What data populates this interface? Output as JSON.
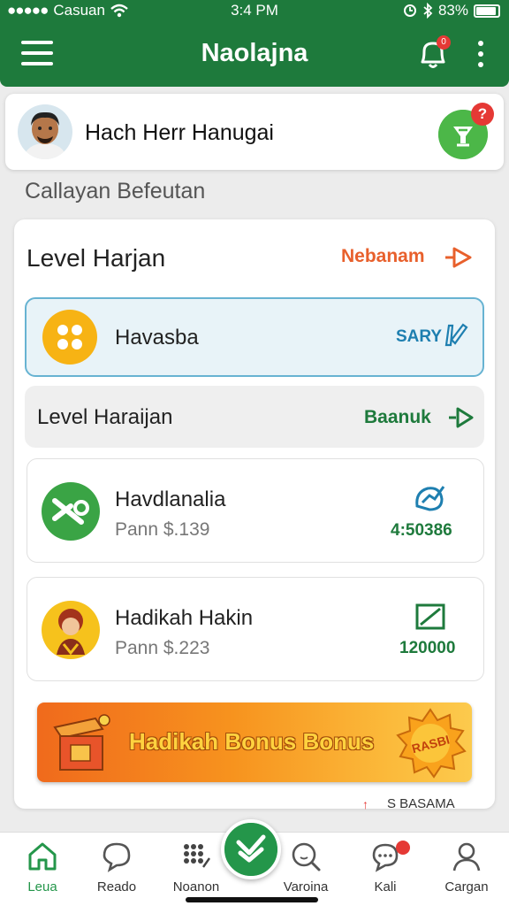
{
  "status": {
    "carrier": "Casuan",
    "time": "3:4 PM",
    "battery": "83%",
    "battery_level": 0.83
  },
  "appbar": {
    "title": "Naolajna",
    "bell_badge": "0"
  },
  "user": {
    "name": "Hach Herr Hanugai",
    "action_badge": "?"
  },
  "section_title": "Callayan Befeutan",
  "level": {
    "heading": "Level Harjan",
    "link_label": "Nebanam"
  },
  "highlight_row": {
    "label": "Havasba",
    "action_label": "SARY"
  },
  "grey_row": {
    "label": "Level Haraijan",
    "link_label": "Baanuk"
  },
  "items": [
    {
      "title": "Havdlanalia",
      "subtitle": "Pann $.139",
      "value": "4:50386"
    },
    {
      "title": "Hadikah Hakin",
      "subtitle": "Pann $.223",
      "value": "120000"
    }
  ],
  "bonus": {
    "text": "Hadikah Bonus Bonus",
    "badge_text": "RASBI"
  },
  "peek": {
    "label": "S BASAMA"
  },
  "nav": [
    {
      "label": "Leua",
      "icon": "home-icon",
      "active": true
    },
    {
      "label": "Reado",
      "icon": "chat-bubble-icon",
      "active": false
    },
    {
      "label": "Noanon",
      "icon": "keypad-icon",
      "active": false
    },
    {
      "label": "Varoina",
      "icon": "search-icon",
      "active": false
    },
    {
      "label": "Kali",
      "icon": "message-icon",
      "active": false
    },
    {
      "label": "Cargan",
      "icon": "person-icon",
      "active": false
    }
  ],
  "colors": {
    "brand_green": "#1e7a3c",
    "accent_orange": "#e8602c",
    "highlight_blue": "#67b3d2",
    "badge_red": "#e53935"
  }
}
